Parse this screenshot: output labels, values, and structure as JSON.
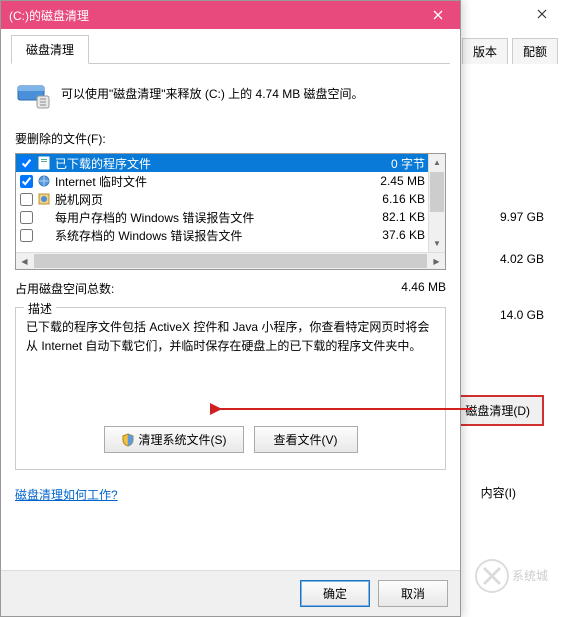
{
  "dialog": {
    "title": "(C:)的磁盘清理",
    "tab": "磁盘清理",
    "intro": "可以使用\"磁盘清理\"来释放 (C:) 上的 4.74 MB 磁盘空间。",
    "files_label": "要删除的文件(F):",
    "rows": [
      {
        "checked": true,
        "label": "已下载的程序文件",
        "size": "0 字节",
        "selected": true
      },
      {
        "checked": true,
        "label": "Internet 临时文件",
        "size": "2.45 MB"
      },
      {
        "checked": false,
        "label": "脱机网页",
        "size": "6.16 KB"
      },
      {
        "checked": false,
        "label": "每用户存档的 Windows 错误报告文件",
        "size": "82.1 KB"
      },
      {
        "checked": false,
        "label": "系统存档的 Windows 错误报告文件",
        "size": "37.6 KB"
      }
    ],
    "total_label": "占用磁盘空间总数:",
    "total_value": "4.46 MB",
    "desc_title": "描述",
    "desc_text": "已下载的程序文件包括 ActiveX 控件和 Java 小程序，你查看特定网页时将会从 Internet 自动下载它们，并临时保存在硬盘上的已下载的程序文件夹中。",
    "clean_sys_btn": "清理系统文件(S)",
    "view_files_btn": "查看文件(V)",
    "help_link": "磁盘清理如何工作?",
    "ok": "确定",
    "cancel": "取消"
  },
  "bg": {
    "tabs": [
      "版本",
      "配额"
    ],
    "stat1": "9.97 GB",
    "stat2": "4.02 GB",
    "stat3": "14.0 GB",
    "clean_btn": "磁盘清理(D)",
    "content_label": "内容(I)",
    "watermark": "系统城"
  }
}
